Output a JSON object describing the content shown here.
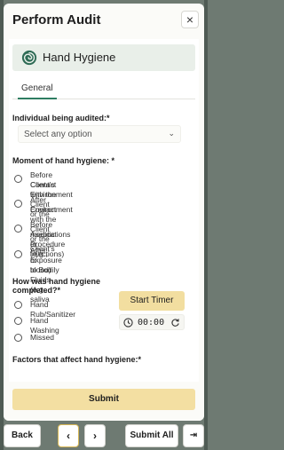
{
  "modal": {
    "title": "Perform Audit",
    "close_label": "×"
  },
  "section": {
    "title": "Hand Hygiene",
    "icon": "spiral-logo-icon"
  },
  "tabs": [
    {
      "label": "General",
      "active": true
    }
  ],
  "fields": {
    "individual_label": "Individual being audited:*",
    "individual_placeholder": "Select any option",
    "moment_label": "Moment of hand hygiene: *",
    "moment_options": [
      {
        "line1": "Before Contact with the Client or the",
        "line2": "Client's Environment"
      },
      {
        "line1": "After Contact with the Client or the Client's",
        "line2": "Environment"
      },
      {
        "line1": "Before Aseptic Procedure (e.g.,",
        "line2": "medications or injections)"
      },
      {
        "line1": "After Exposure to Bodily Fluids (e.g., saliva",
        "line2": "or blood)"
      }
    ],
    "completed_label_1": "How was hand hygiene",
    "completed_label_2": "completed?*",
    "completed_options": [
      "Hand Rub/Sanitizer",
      "Hand Washing",
      "Missed"
    ],
    "factors_label": "Factors that affect hand hygiene:*"
  },
  "timer": {
    "start_label": "Start Timer",
    "display": "00:00"
  },
  "actions": {
    "submit_label": "Submit"
  },
  "bottom_nav": {
    "back_label": "Back",
    "prev_label": "‹",
    "next_label": "›",
    "submit_all_label": "Submit All",
    "exit_label": "⇥"
  },
  "colors": {
    "accent": "#f2dea0",
    "tab_underline": "#2e7d62",
    "banner_bg": "#e9efe9"
  }
}
